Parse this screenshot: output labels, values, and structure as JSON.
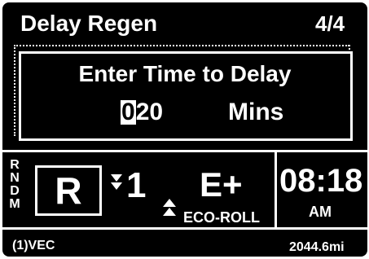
{
  "header": {
    "title": "Delay Regen",
    "page_indicator": "4/4"
  },
  "dialog": {
    "prompt": "Enter Time to Delay",
    "delay_value": {
      "selected_digit": "0",
      "remaining_digits": "20"
    },
    "unit": "Mins"
  },
  "drive_info": {
    "gear_positions": [
      "R",
      "N",
      "D",
      "M"
    ],
    "current_gear": "R",
    "gear_number": "1",
    "shift_down_icon": "double-down-arrow-icon",
    "shift_up_icon": "double-up-arrow-icon",
    "eco_level": "E+",
    "eco_roll_label": "ECO-ROLL"
  },
  "clock": {
    "time": "08:18",
    "period": "AM"
  },
  "footer": {
    "source": "(1)VEC",
    "odometer": "2044.6mi"
  },
  "colors": {
    "background": "#000000",
    "foreground": "#ffffff"
  }
}
